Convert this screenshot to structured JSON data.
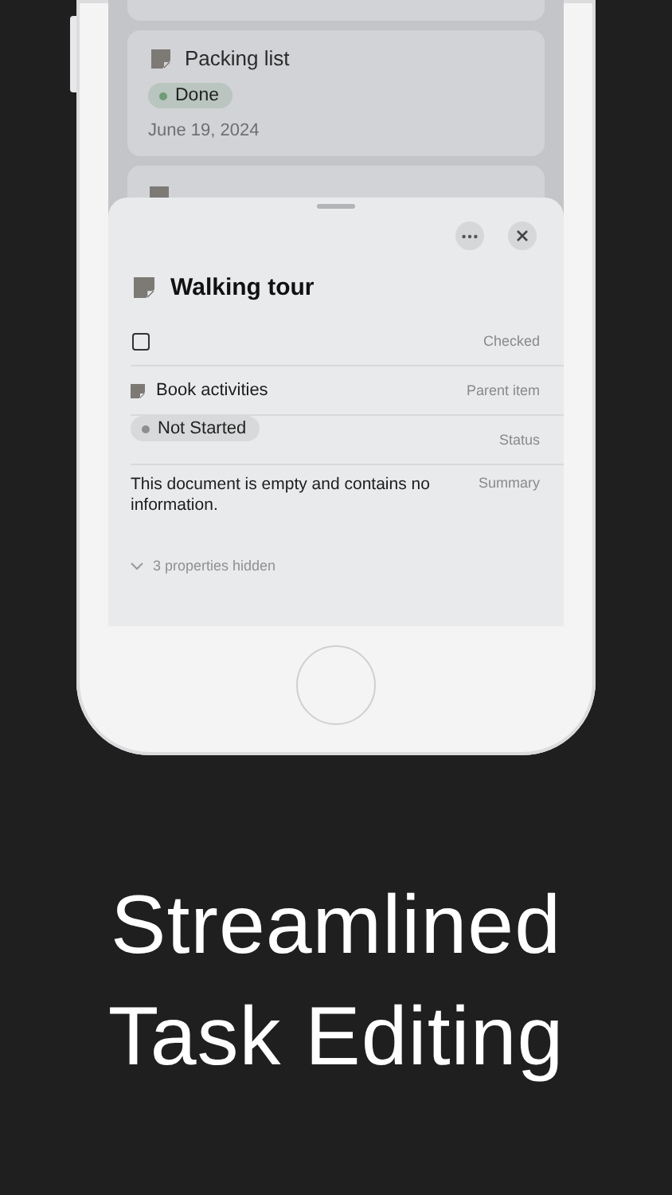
{
  "cards": [
    {
      "kind": "partial-bottom"
    },
    {
      "kind": "full",
      "title": "Packing list",
      "status": {
        "label": "Done",
        "color": "#6f9c77"
      },
      "date": "June 19, 2024"
    },
    {
      "kind": "partial-top"
    }
  ],
  "sheet": {
    "title": "Walking tour",
    "properties": [
      {
        "kind": "checkbox",
        "checked": false,
        "label": "Checked"
      },
      {
        "kind": "relation",
        "value": "Book activities",
        "label": "Parent item"
      },
      {
        "kind": "status",
        "value": "Not Started",
        "color": "#8e8e90",
        "label": "Status"
      },
      {
        "kind": "text",
        "value": "This document is empty and contains no information.",
        "label": "Summary"
      }
    ],
    "hidden": "3 properties hidden"
  },
  "headline": [
    "Streamlined",
    "Task Editing"
  ]
}
